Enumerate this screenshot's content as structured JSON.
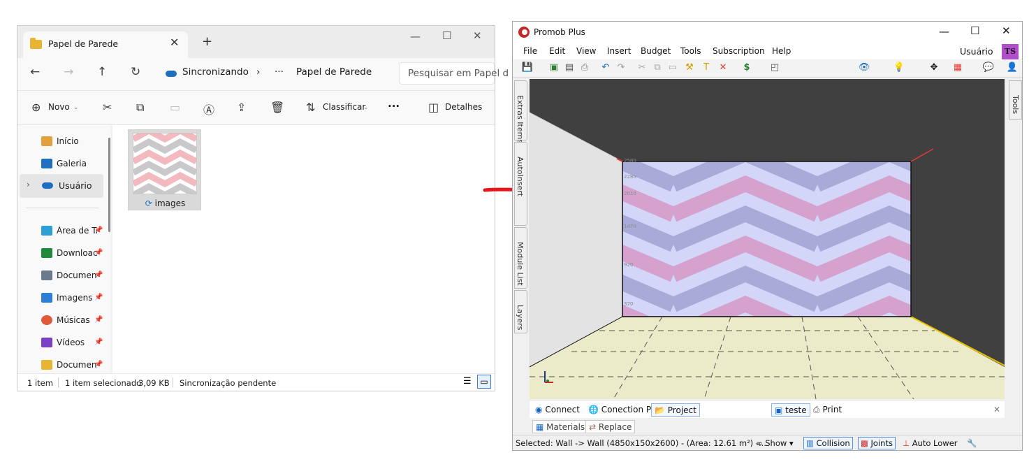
{
  "explorer": {
    "tab_title": "Papel de Parede",
    "tab_close": "✕",
    "new_tab": "+",
    "window_controls": {
      "minimize": "—",
      "maximize": "☐",
      "close": "✕"
    },
    "nav_buttons": {
      "back": "←",
      "forward": "→",
      "up": "↑",
      "refresh": "↻"
    },
    "breadcrumb": {
      "sync_label": "Sincronizando",
      "separator": "›",
      "ellipsis": "···",
      "current": "Papel de Parede"
    },
    "search_placeholder": "Pesquisar em Papel d",
    "command_bar": {
      "new_label": "Novo",
      "sort_label": "Classificar",
      "more": "···",
      "details_label": "Detalhes"
    },
    "sidebar": {
      "items": [
        {
          "label": "Início",
          "icon": "home-icon",
          "color": "#e2a23b"
        },
        {
          "label": "Galeria",
          "icon": "gallery-icon",
          "color": "#1e6fc2"
        },
        {
          "label": "Usuário",
          "icon": "onedrive-cloud-icon",
          "color": "#1e6fc2"
        },
        {
          "label": "Área de Tr",
          "icon": "desktop-icon",
          "color": "#2b9fd6"
        },
        {
          "label": "Downloac",
          "icon": "download-icon",
          "color": "#1e8a3a"
        },
        {
          "label": "Documen",
          "icon": "document-icon",
          "color": "#6b7b8c"
        },
        {
          "label": "Imagens",
          "icon": "pictures-icon",
          "color": "#2b7fd6"
        },
        {
          "label": "Músicas",
          "icon": "music-icon",
          "color": "#e05a3a"
        },
        {
          "label": "Vídeos",
          "icon": "video-icon",
          "color": "#7b3fc4"
        },
        {
          "label": "Documen",
          "icon": "folder-icon",
          "color": "#e8b532"
        }
      ]
    },
    "file": {
      "name": "images",
      "sync_icon": "sync-icon"
    },
    "status": {
      "count": "1 item",
      "selected": "1 item selecionado",
      "size": "3,09 KB",
      "sync": "Sincronização pendente"
    }
  },
  "promob": {
    "title": "Promob Plus",
    "window_controls": {
      "minimize": "—",
      "maximize": "☐",
      "close": "✕"
    },
    "menu": [
      "File",
      "Edit",
      "View",
      "Insert",
      "Budget",
      "Tools",
      "Subscription",
      "Help"
    ],
    "user_label": "Usuário",
    "avatar": "TS",
    "left_tabs": [
      "Extras Items",
      "AutoInsert",
      "Module List",
      "Layers"
    ],
    "right_tab": "Tools",
    "viewport": {
      "wall_labels": [
        "2580",
        "2280",
        "2010",
        "1470",
        "920",
        "370"
      ],
      "wallpaper_colors": {
        "stripe1": "#d8a6c8",
        "stripe2": "#a9aee0",
        "bg": "#cfd3f8"
      }
    },
    "bottom_tabs": {
      "connect": "Connect",
      "conection": "Conection P",
      "project": "Project",
      "teste": "teste",
      "print": "Print",
      "close": "✕"
    },
    "bottom_tabs2": {
      "materials": "Materials",
      "replace": "Replace"
    },
    "status": {
      "selected": "Selected: Wall -> Wall (4850x150x2600) - (Area: 12.61 m²) -...",
      "show": "Show",
      "collision": "Collision",
      "joints": "Joints",
      "auto_lower": "Auto Lower"
    }
  }
}
